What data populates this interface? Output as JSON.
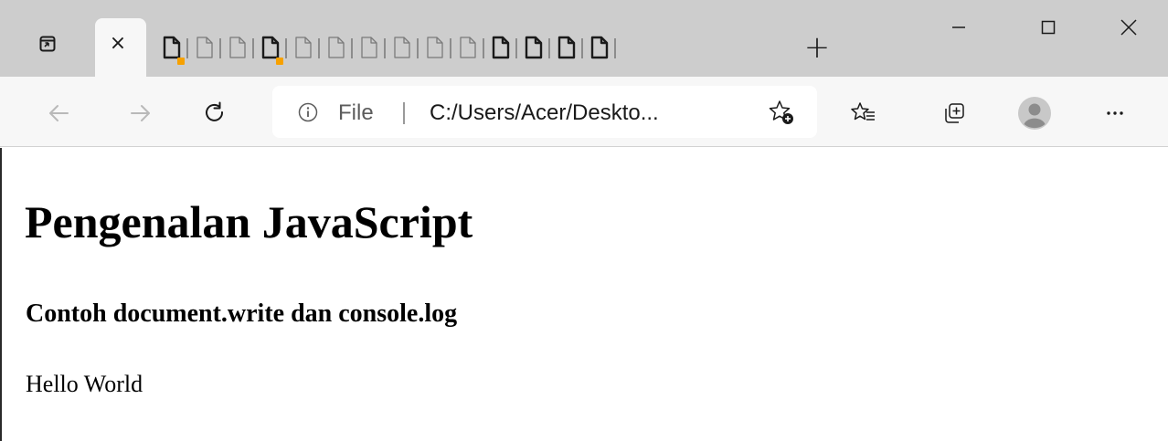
{
  "tabstrip": {
    "active_tab": {
      "close_glyph": "×"
    },
    "pinned_tabs": [
      {
        "icon": "document-icon",
        "bold": true,
        "badge": true
      },
      {
        "icon": "document-icon",
        "bold": false,
        "badge": false
      },
      {
        "icon": "document-icon",
        "bold": false,
        "badge": false
      },
      {
        "icon": "document-icon",
        "bold": true,
        "badge": true
      },
      {
        "icon": "document-icon",
        "bold": false,
        "badge": false
      },
      {
        "icon": "document-icon",
        "bold": false,
        "badge": false
      },
      {
        "icon": "document-icon",
        "bold": false,
        "badge": false
      },
      {
        "icon": "document-icon",
        "bold": false,
        "badge": false
      },
      {
        "icon": "document-icon",
        "bold": false,
        "badge": false
      },
      {
        "icon": "document-icon",
        "bold": false,
        "badge": false
      },
      {
        "icon": "document-icon",
        "bold": true,
        "badge": false
      },
      {
        "icon": "document-icon",
        "bold": true,
        "badge": false
      },
      {
        "icon": "document-icon",
        "bold": true,
        "badge": false
      },
      {
        "icon": "document-icon",
        "bold": true,
        "badge": false
      }
    ],
    "new_tab_glyph": "+",
    "badge_color": "#f7a100"
  },
  "address_bar": {
    "scheme": "File",
    "url": "C:/Users/Acer/Deskto..."
  },
  "page": {
    "heading": "Pengenalan JavaScript",
    "subheading": "Contoh document.write dan console.log",
    "text": "Hello World"
  }
}
